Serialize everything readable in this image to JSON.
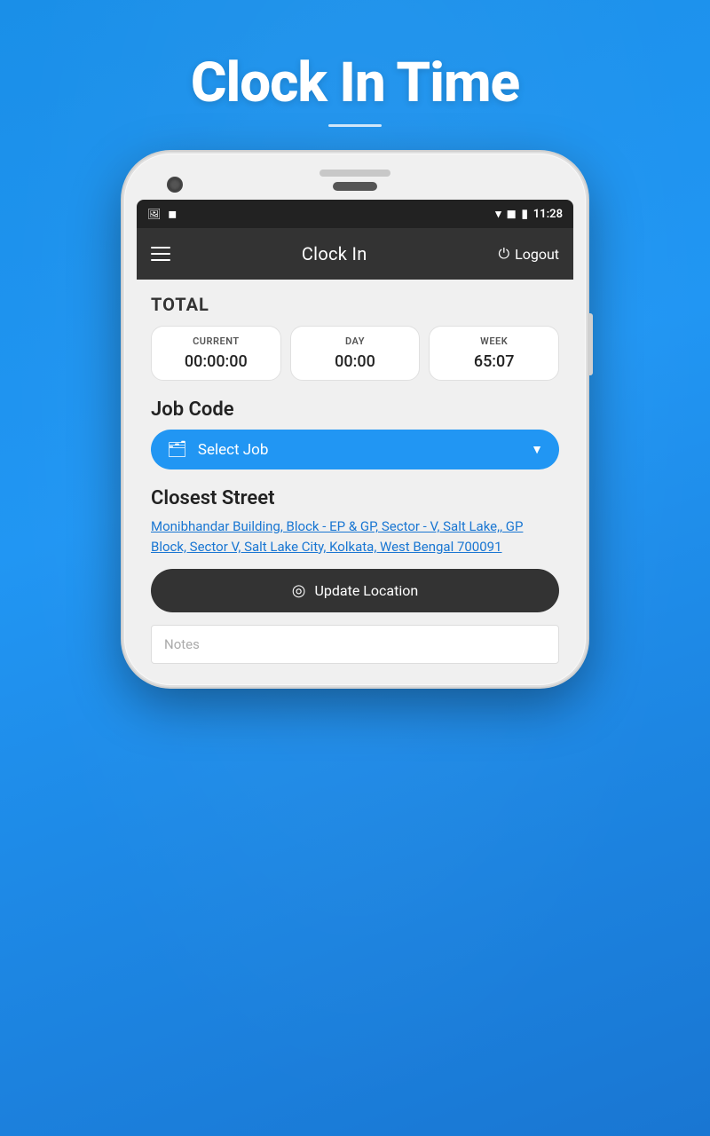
{
  "page": {
    "title": "Clock In Time",
    "title_underline": true,
    "background_color": "#2196f3"
  },
  "status_bar": {
    "time": "11:28",
    "icons_left": [
      "image-icon",
      "notification-icon"
    ],
    "icons_right": [
      "wifi-icon",
      "signal-icon",
      "battery-icon"
    ]
  },
  "app_bar": {
    "title": "Clock In",
    "logout_label": "Logout",
    "menu_icon": "menu-icon",
    "logout_icon": "power-icon"
  },
  "total_section": {
    "label": "TOTAL",
    "cards": [
      {
        "label": "CURRENT",
        "value": "00:00:00"
      },
      {
        "label": "DAY",
        "value": "00:00"
      },
      {
        "label": "WEEK",
        "value": "65:07"
      }
    ]
  },
  "job_code_section": {
    "label": "Job Code",
    "select_placeholder": "Select Job",
    "icon": "briefcase-icon"
  },
  "closest_street_section": {
    "label": "Closest Street",
    "address": "Monibhandar Building, Block - EP & GP, Sector - V, Salt Lake,, GP Block, Sector V, Salt Lake City, Kolkata, West Bengal 700091"
  },
  "update_location": {
    "label": "Update Location",
    "icon": "location-icon"
  },
  "notes": {
    "placeholder": "Notes"
  }
}
